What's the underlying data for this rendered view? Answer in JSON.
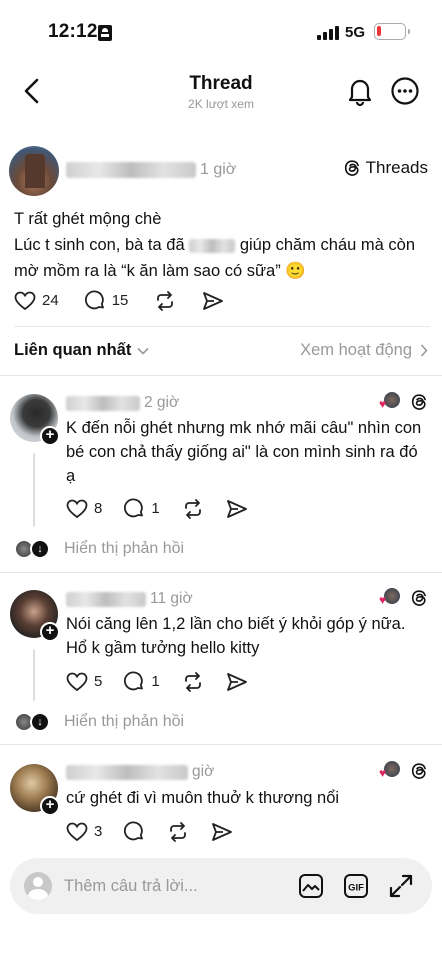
{
  "status_bar": {
    "time": "12:12",
    "network": "5G"
  },
  "header": {
    "title": "Thread",
    "subtitle": "2K lượt xem"
  },
  "post": {
    "time": "1 giờ",
    "badge": "Threads",
    "lines": [
      "T rất ghét mộng chè",
      "Lúc t sinh con, bà ta đã",
      "giúp chăm cháu mà còn",
      "mờ mồm ra là “k ăn làm sao có sữa”",
      "🙂"
    ],
    "likes": "24",
    "comments": "15"
  },
  "sort": {
    "label": "Liên quan nhất",
    "activity": "Xem hoạt động"
  },
  "replies": [
    {
      "time": "2 giờ",
      "text": "K đến nỗi ghét nhưng mk nhớ mãi câu\" nhìn con bé con chả thấy giống ai\" là con mình sinh ra đó ạ",
      "likes": "8",
      "comments": "1",
      "show_replies": "Hiển thị phản hồi"
    },
    {
      "time": "11 giờ",
      "text": "Nói căng lên 1,2 lần cho biết ý khỏi góp ý nữa. Hổ k gầm tưởng hello kitty",
      "likes": "5",
      "comments": "1",
      "show_replies": "Hiển thị phản hồi"
    },
    {
      "time": "giờ",
      "text": "cứ ghét đi vì muôn thuở k thương nổi",
      "likes": "3",
      "comments": ""
    }
  ],
  "composer": {
    "placeholder": "Thêm câu trả lời..."
  },
  "colors": {
    "heart_red": "#e0245e",
    "muted": "#999999",
    "line": "#e6e6e6"
  }
}
